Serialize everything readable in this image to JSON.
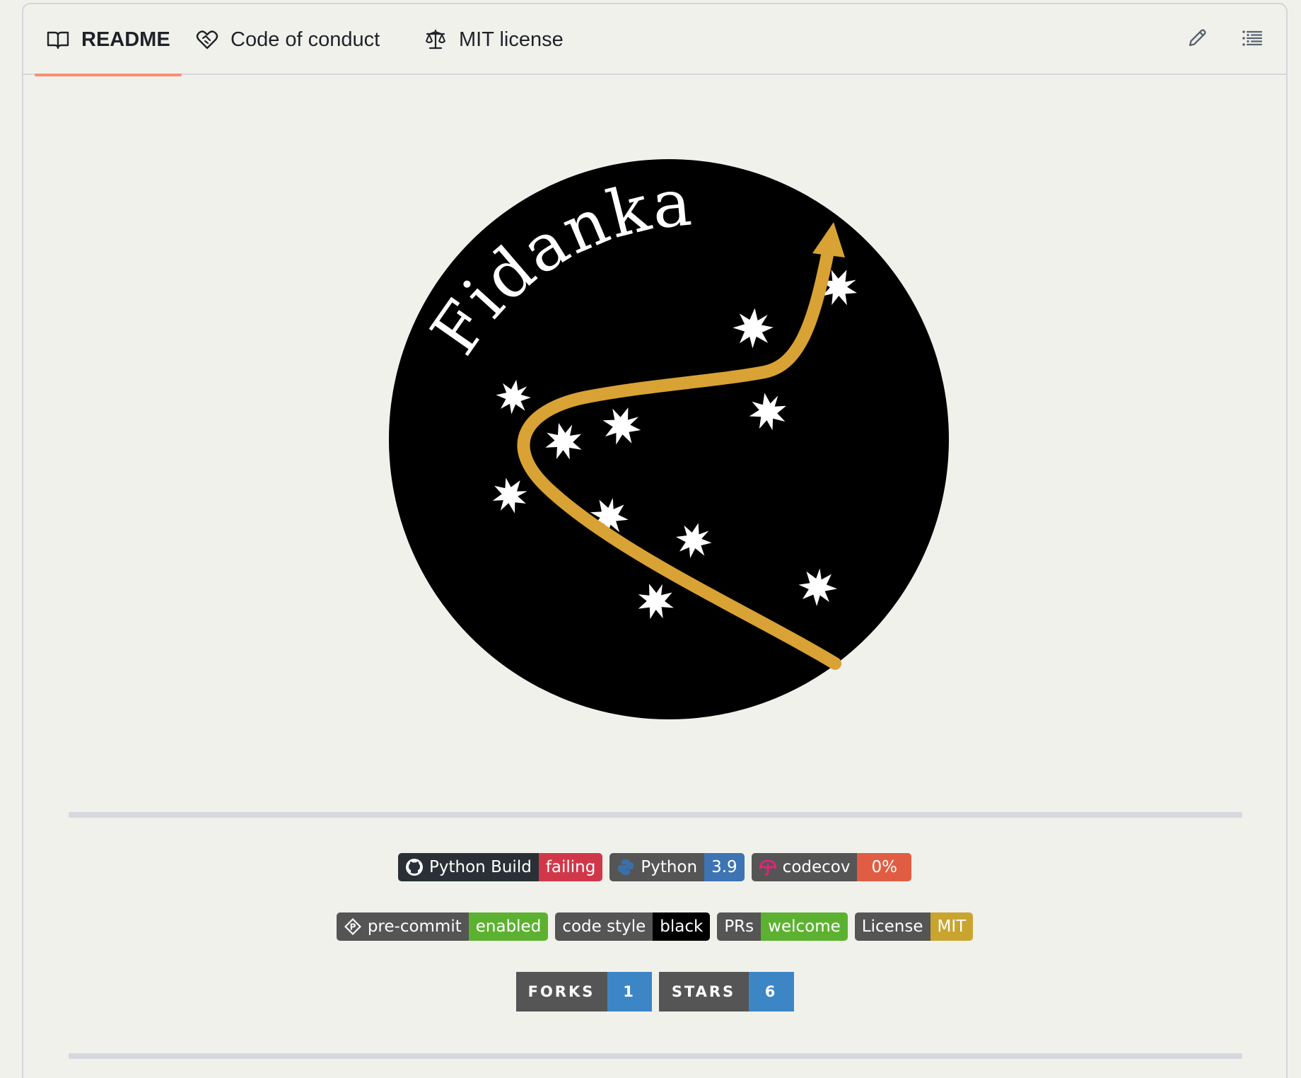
{
  "tabs": [
    {
      "label": "README",
      "icon": "book-icon",
      "active": true
    },
    {
      "label": "Code of conduct",
      "icon": "heart-handshake-icon",
      "active": false
    },
    {
      "label": "MIT license",
      "icon": "scale-icon",
      "active": false
    }
  ],
  "toolbar": {
    "edit_icon": "pencil-icon",
    "toc_icon": "list-icon"
  },
  "logo": {
    "text": "Fidanka",
    "background": "#000000",
    "curve_color": "#d9a234",
    "star_color": "#ffffff"
  },
  "badges": {
    "row1": [
      {
        "label": "Python Build",
        "value": "failing",
        "icon": "github-icon",
        "label_color": "#555555",
        "value_color": "#e05d44"
      },
      {
        "label": "Python",
        "value": "3.9",
        "icon": "python-icon",
        "label_color": "#555555",
        "value_color": "#3776ab"
      },
      {
        "label": "codecov",
        "value": "0%",
        "icon": "codecov-umbrella-icon",
        "label_color": "#555555",
        "value_color": "#e05d44"
      }
    ],
    "row2": [
      {
        "label": "pre-commit",
        "value": "enabled",
        "icon": "pre-commit-icon",
        "label_color": "#555555",
        "value_color": "#4c1"
      },
      {
        "label": "code style",
        "value": "black",
        "label_color": "#555555",
        "value_color": "#000000"
      },
      {
        "label": "PRs",
        "value": "welcome",
        "label_color": "#555555",
        "value_color": "#4c1"
      },
      {
        "label": "License",
        "value": "MIT",
        "label_color": "#555555",
        "value_color": "#dfb317"
      }
    ],
    "social": [
      {
        "label": "FORKS",
        "value": "1"
      },
      {
        "label": "STARS",
        "value": "6"
      }
    ]
  }
}
